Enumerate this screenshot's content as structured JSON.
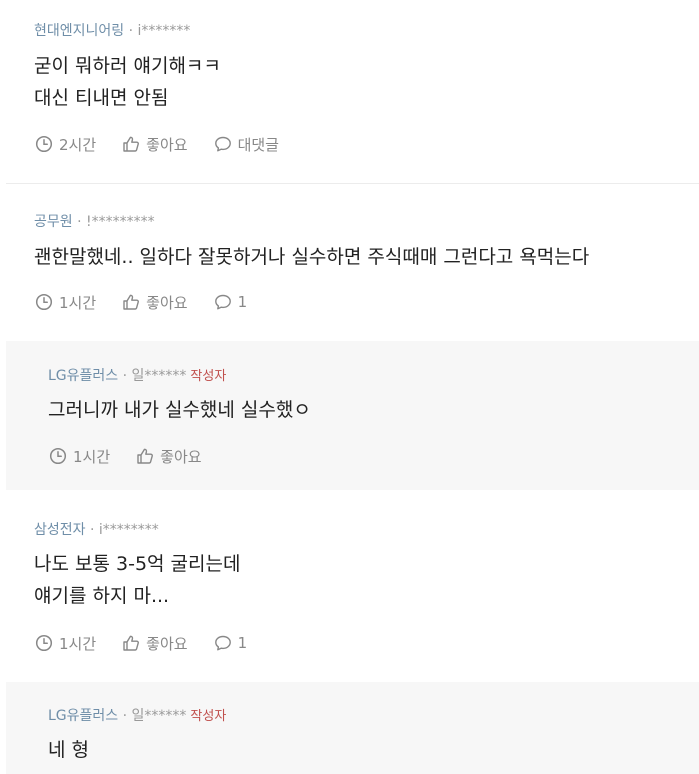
{
  "comments": [
    {
      "company": "현대엔지니어링",
      "sep": " · ",
      "user": "i*******",
      "badge": "",
      "body": "굳이 뭐하러 얘기해ㅋㅋ\n대신 티내면 안됨",
      "time": "2시간",
      "like_label": "좋아요",
      "reply_label": "대댓글"
    },
    {
      "company": "공무원",
      "sep": " · ",
      "user": "!*********",
      "badge": "",
      "body": "괜한말했네.. 일하다 잘못하거나 실수하면 주식때매 그런다고 욕먹는다",
      "time": "1시간",
      "like_label": "좋아요",
      "reply_label": "1"
    },
    {
      "company": "LG유플러스",
      "sep": " · ",
      "user": "일******",
      "badge": "작성자",
      "body": "그러니까 내가 실수했네 실수했ㅇ",
      "time": "1시간",
      "like_label": "좋아요",
      "reply_label": ""
    },
    {
      "company": "삼성전자",
      "sep": " · ",
      "user": "i********",
      "badge": "",
      "body": "나도 보통 3-5억 굴리는데\n얘기를 하지 마...",
      "time": "1시간",
      "like_label": "좋아요",
      "reply_label": "1"
    },
    {
      "company": "LG유플러스",
      "sep": " · ",
      "user": "일******",
      "badge": "작성자",
      "body": "네 형",
      "time": "",
      "like_label": "",
      "reply_label": ""
    }
  ],
  "icons": {
    "time": "clock-icon",
    "like": "thumbs-up-icon",
    "reply": "speech-bubble-icon"
  }
}
